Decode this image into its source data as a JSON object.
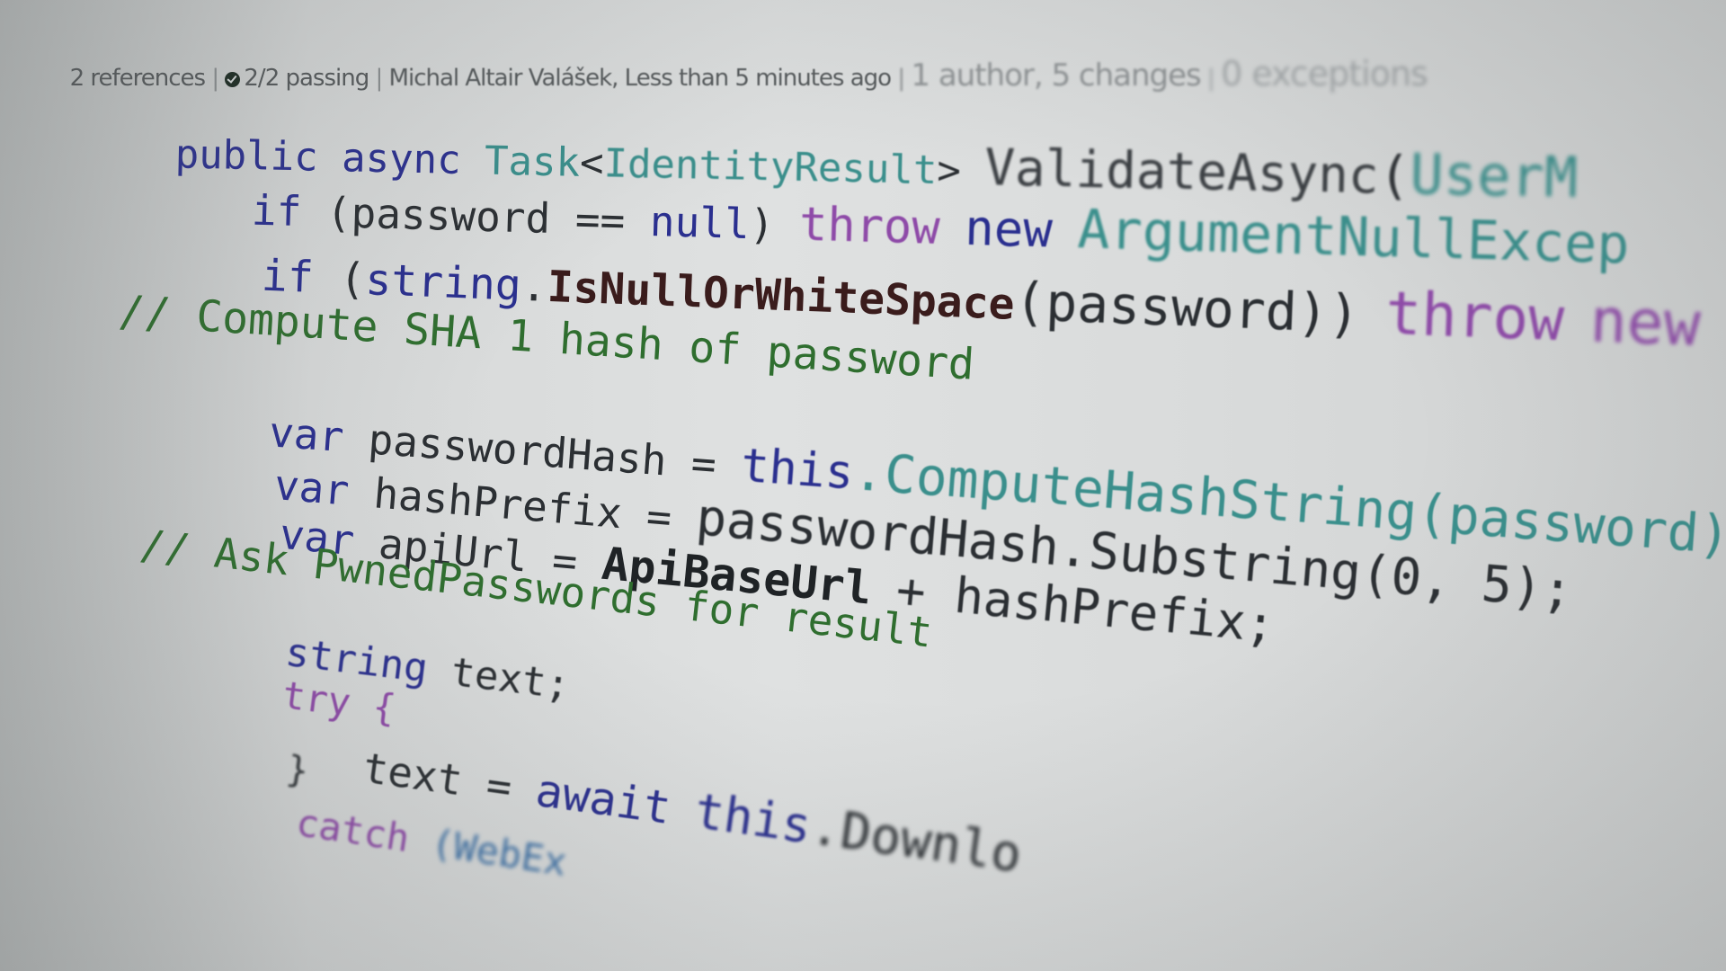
{
  "codelens": {
    "references": "2 references",
    "passing": "2/2 passing",
    "author_time": "Michal Altair Valášek, Less than 5 minutes ago",
    "authors": "1 author, 5 changes",
    "exceptions": "0 exceptions"
  },
  "code": {
    "l1_public": "public",
    "l1_async": "async",
    "l1_task": "Task",
    "l1_lt": "<",
    "l1_identity": "IdentityResult",
    "l1_gt": ">",
    "l1_method": "ValidateAsync",
    "l1_paren": "(",
    "l1_param": "UserM",
    "l2_if": "if",
    "l2_cond": "(password ==",
    "l2_null": "null",
    "l2_close": ")",
    "l2_throw": "throw",
    "l2_new": "new",
    "l2_exc": "ArgumentNullExcep",
    "l3_if": "if",
    "l3_open": "(",
    "l3_string": "string",
    "l3_dot": ".",
    "l3_method": "IsNullOrWhiteSpace",
    "l3_args": "(password))",
    "l3_throw": "throw",
    "l3_new": "new",
    "l4_comment": "// Compute SHA 1 hash of password",
    "l5_var": "var",
    "l5_name": "passwordHash =",
    "l5_this": "this",
    "l5_call": ".ComputeHashString(password)",
    "l6_var": "var",
    "l6_name": "hashPrefix =",
    "l6_call": "passwordHash.Substring(0, 5);",
    "l7_var": "var",
    "l7_name": "apiUrl =",
    "l7_base": "ApiBaseUrl",
    "l7_rest": "+ hashPrefix;",
    "l8_comment": "// Ask PwnedPasswords for result",
    "l9_string": "string",
    "l9_rest": "text;",
    "l10_try": "try {",
    "l11_text": "text =",
    "l11_await": "await",
    "l11_this": "this",
    "l11_rest": ".Downlo",
    "l12_brace": "}",
    "l13_catch": "catch",
    "l13_rest": "(WebEx"
  },
  "colors": {
    "keyword": "#2a2f8f",
    "type": "#3a8f8c",
    "control": "#8e4aa8",
    "comment": "#2f6e2f",
    "identifier": "#2b2f33"
  }
}
